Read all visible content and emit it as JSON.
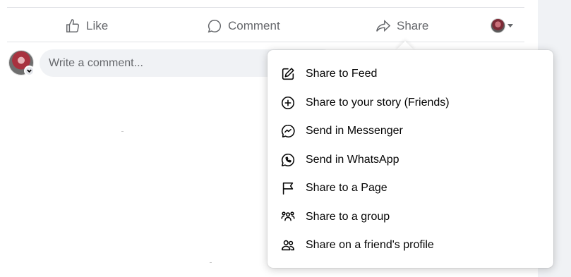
{
  "post_actions": {
    "like_label": "Like",
    "comment_label": "Comment",
    "share_label": "Share"
  },
  "comment_box": {
    "placeholder": "Write a comment..."
  },
  "share_menu": {
    "items": [
      {
        "label": "Share to Feed",
        "icon": "edit-icon"
      },
      {
        "label": "Share to your story (Friends)",
        "icon": "add-story-icon"
      },
      {
        "label": "Send in Messenger",
        "icon": "messenger-icon"
      },
      {
        "label": "Send in WhatsApp",
        "icon": "whatsapp-icon"
      },
      {
        "label": "Share to a Page",
        "icon": "flag-icon"
      },
      {
        "label": "Share to a group",
        "icon": "group-icon"
      },
      {
        "label": "Share on a friend's profile",
        "icon": "friends-icon"
      }
    ]
  },
  "colors": {
    "secondary_text": "#65676b",
    "primary_text": "#050505",
    "input_bg": "#f0f2f5",
    "divider": "#dfe1e5"
  }
}
